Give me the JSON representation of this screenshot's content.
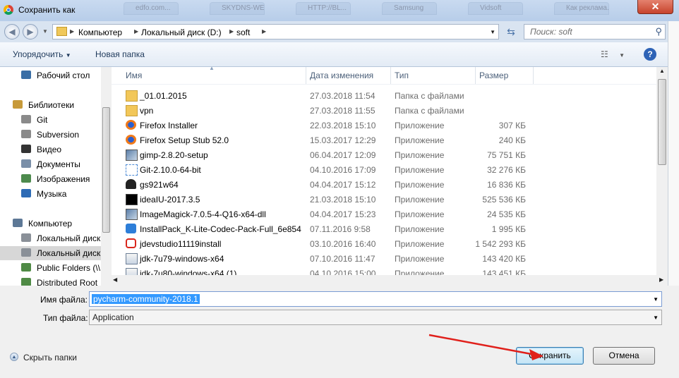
{
  "window": {
    "title": "Сохранить как",
    "close": "✕"
  },
  "background_tabs": [
    "еdfo.com...",
    "SKYDNS-WE...",
    "HTTP://BL...",
    "Samsung",
    "Vidsoft",
    "Как реклама..."
  ],
  "address": {
    "crumbs": [
      "Компьютер",
      "Локальный диск (D:)",
      "soft"
    ],
    "search_placeholder": "Поиск: soft"
  },
  "toolbar": {
    "organize": "Упорядочить",
    "new_folder": "Новая папка",
    "help": "?"
  },
  "nav": [
    {
      "label": "Рабочий стол",
      "icon": "desktop-icon"
    },
    {
      "label": "Библиотеки",
      "icon": "libraries-icon"
    },
    {
      "label": "Git",
      "icon": "git-library-icon"
    },
    {
      "label": "Subversion",
      "icon": "subversion-library-icon"
    },
    {
      "label": "Видео",
      "icon": "video-icon"
    },
    {
      "label": "Документы",
      "icon": "documents-icon"
    },
    {
      "label": "Изображения",
      "icon": "images-icon"
    },
    {
      "label": "Музыка",
      "icon": "music-icon"
    },
    {
      "label": "Компьютер",
      "icon": "computer-icon"
    },
    {
      "label": "Локальный диск",
      "icon": "system-drive-icon"
    },
    {
      "label": "Локальный диск",
      "icon": "drive-icon",
      "selected": true
    },
    {
      "label": "Public Folders (\\\\",
      "icon": "network-drive-icon"
    },
    {
      "label": "Distributed Root",
      "icon": "network-drive-icon"
    }
  ],
  "columns": {
    "name": "Имя",
    "date": "Дата изменения",
    "type": "Тип",
    "size": "Размер"
  },
  "files": [
    {
      "name": "_01.01.2015",
      "date": "27.03.2018 11:54",
      "type": "Папка с файлами",
      "size": "",
      "icon": "folder-icon"
    },
    {
      "name": "vpn",
      "date": "27.03.2018 11:55",
      "type": "Папка с файлами",
      "size": "",
      "icon": "folder-icon"
    },
    {
      "name": "Firefox Installer",
      "date": "22.03.2018 15:10",
      "type": "Приложение",
      "size": "307 КБ",
      "icon": "firefox-icon"
    },
    {
      "name": "Firefox Setup Stub 52.0",
      "date": "15.03.2017 12:29",
      "type": "Приложение",
      "size": "240 КБ",
      "icon": "firefox-icon"
    },
    {
      "name": "gimp-2.8.20-setup",
      "date": "06.04.2017 12:09",
      "type": "Приложение",
      "size": "75 751 КБ",
      "icon": "installer-icon"
    },
    {
      "name": "Git-2.10.0-64-bit",
      "date": "04.10.2016 17:09",
      "type": "Приложение",
      "size": "32 276 КБ",
      "icon": "git-icon"
    },
    {
      "name": "gs921w64",
      "date": "04.04.2017 15:12",
      "type": "Приложение",
      "size": "16 836 КБ",
      "icon": "ghostscript-icon"
    },
    {
      "name": "ideaIU-2017.3.5",
      "date": "21.03.2018 15:10",
      "type": "Приложение",
      "size": "525 536 КБ",
      "icon": "intellij-icon"
    },
    {
      "name": "ImageMagick-7.0.5-4-Q16-x64-dll",
      "date": "04.04.2017 15:23",
      "type": "Приложение",
      "size": "24 535 КБ",
      "icon": "installer-icon"
    },
    {
      "name": "InstallPack_K-Lite-Codec-Pack-Full_6e854",
      "date": "07.11.2016 9:58",
      "type": "Приложение",
      "size": "1 995 КБ",
      "icon": "download-icon"
    },
    {
      "name": "jdevstudio11119install",
      "date": "03.10.2016 16:40",
      "type": "Приложение",
      "size": "1 542 293 КБ",
      "icon": "oracle-icon"
    },
    {
      "name": "jdk-7u79-windows-x64",
      "date": "07.10.2016 11:47",
      "type": "Приложение",
      "size": "143 420 КБ",
      "icon": "java-icon"
    },
    {
      "name": "jdk-7u80-windows-x64 (1)",
      "date": "04.10.2016 15:00",
      "type": "Приложение",
      "size": "143 451 КБ",
      "icon": "java-icon"
    }
  ],
  "form": {
    "filename_label": "Имя файла:",
    "filename_value": "pycharm-community-2018.1",
    "filetype_label": "Тип файла:",
    "filetype_value": "Application"
  },
  "buttons": {
    "hide_folders": "Скрыть папки",
    "save": "Сохранить",
    "cancel": "Отмена"
  },
  "colors": {
    "selection": "#3399ff",
    "annotation_arrow": "#e0201b"
  }
}
